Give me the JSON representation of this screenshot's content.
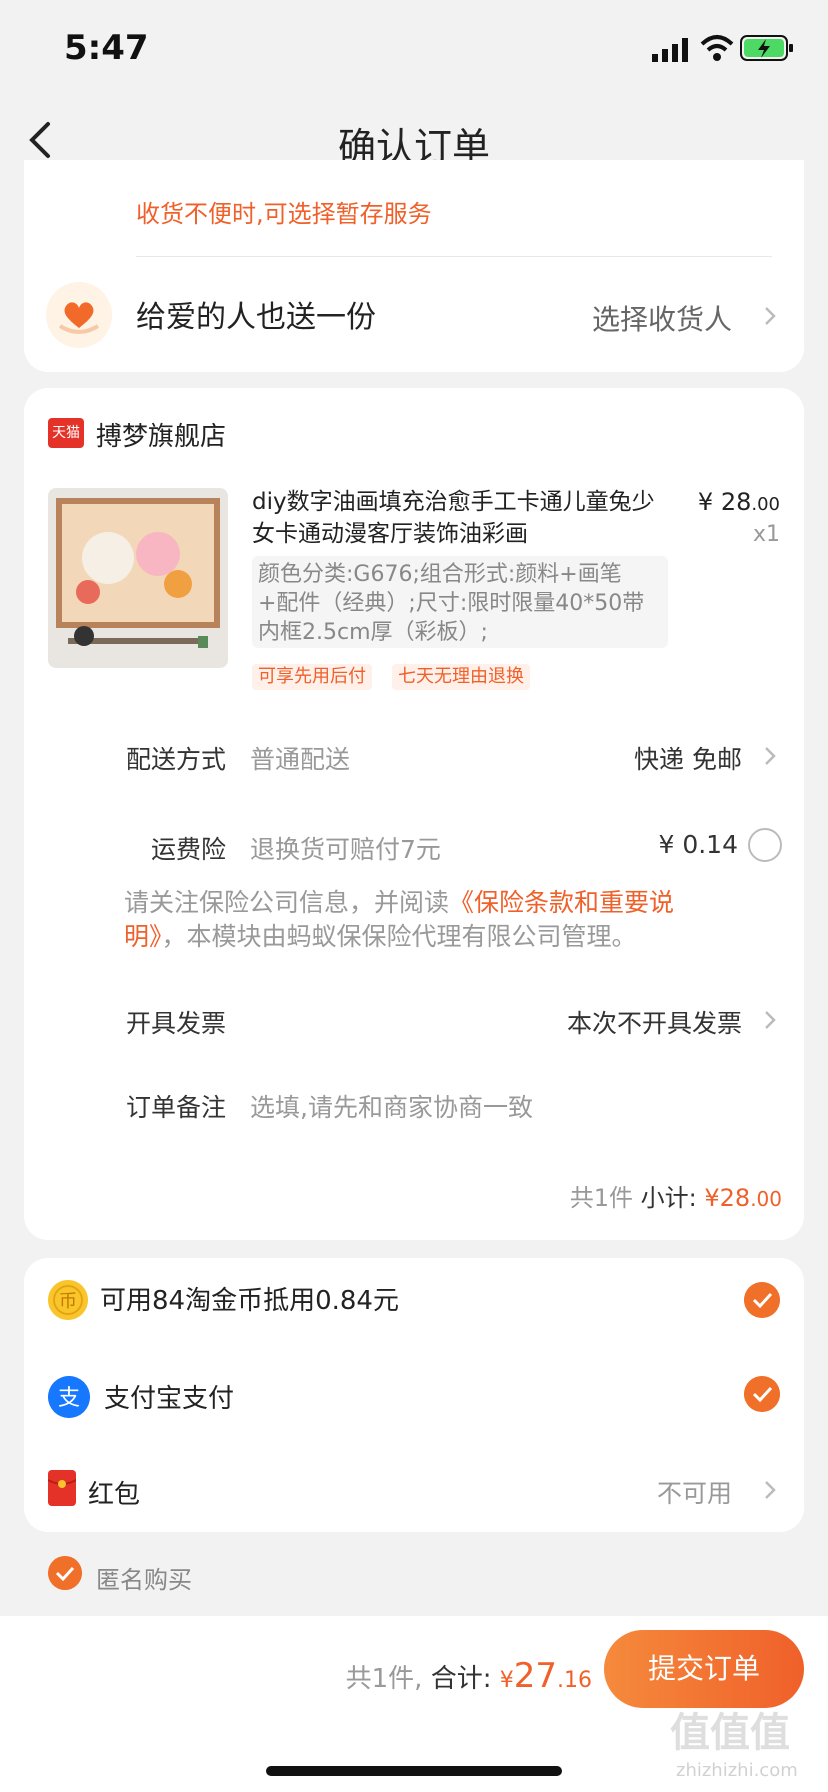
{
  "status_bar": {
    "time": "5:47"
  },
  "nav": {
    "title": "确认订单"
  },
  "address_card": {
    "tip": "收货不便时,可选择暂存服务",
    "gift_title": "给爱的人也送一份",
    "gift_action": "选择收货人"
  },
  "store": {
    "logo_text": "天猫",
    "name": "搏梦旗舰店"
  },
  "product": {
    "title": "diy数字油画填充治愈手工卡通儿童兔少女卡通动漫客厅装饰油彩画",
    "price_symbol": "¥",
    "price_main": "28",
    "price_decimal": ".00",
    "qty": "x1",
    "sku": "颜色分类:G676;组合形式:颜料+画笔+配件（经典）;尺寸:限时限量40*50带内框2.5cm厚（彩板）;",
    "tags": [
      "可享先用后付",
      "七天无理由退换"
    ]
  },
  "delivery": {
    "label": "配送方式",
    "value": "普通配送",
    "right": "快递 免邮"
  },
  "insurance": {
    "label": "运费险",
    "value": "退换货可赔付7元",
    "price": "¥ 0.14"
  },
  "notice": {
    "prefix": "请关注保险公司信息，并阅读",
    "link": "《保险条款和重要说明》",
    "suffix": "，本模块由蚂蚁保保险代理有限公司管理。"
  },
  "invoice": {
    "label": "开具发票",
    "right": "本次不开具发票"
  },
  "remark": {
    "label": "订单备注",
    "placeholder": "选填,请先和商家协商一致"
  },
  "subtotal": {
    "count": "共1件",
    "label": "小计:",
    "symbol": "¥",
    "main": "28",
    "decimal": ".00"
  },
  "payment": {
    "coin_text": "可用84淘金币抵用0.84元",
    "alipay_text": "支付宝支付",
    "hongbao_label": "红包",
    "hongbao_status": "不可用"
  },
  "anonymous": {
    "label": "匿名购买"
  },
  "bottom": {
    "count": "共1件,",
    "total_label": "合计:",
    "symbol": "¥",
    "total_main": "27",
    "total_decimal": ".16",
    "submit": "提交订单"
  },
  "watermark": {
    "main": "值值值",
    "sub": "zhizhizhi.com"
  },
  "colors": {
    "accent": "#f0602a",
    "alipay": "#1677ff",
    "coin": "#f9c52a"
  }
}
